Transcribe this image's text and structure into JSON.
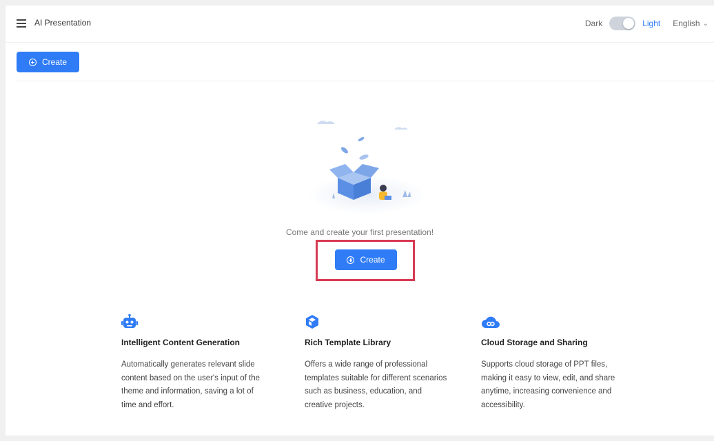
{
  "header": {
    "title": "AI Presentation",
    "theme_dark_label": "Dark",
    "theme_light_label": "Light",
    "language": "English"
  },
  "toolbar": {
    "create_label": "Create"
  },
  "empty_state": {
    "message": "Come and create your first presentation!",
    "create_label": "Create"
  },
  "features": [
    {
      "icon": "robot-icon",
      "title": "Intelligent Content Generation",
      "description": "Automatically generates relevant slide content based on the user's input of the theme and information, saving a lot of time and effort."
    },
    {
      "icon": "cube-icon",
      "title": "Rich Template Library",
      "description": "Offers a wide range of professional templates suitable for different scenarios such as business, education, and creative projects."
    },
    {
      "icon": "cloud-icon",
      "title": "Cloud Storage and Sharing",
      "description": "Supports cloud storage of PPT files, making it easy to view, edit, and share anytime, increasing convenience and accessibility."
    }
  ],
  "colors": {
    "accent": "#2f7cf6",
    "highlight_border": "#d83a52"
  }
}
